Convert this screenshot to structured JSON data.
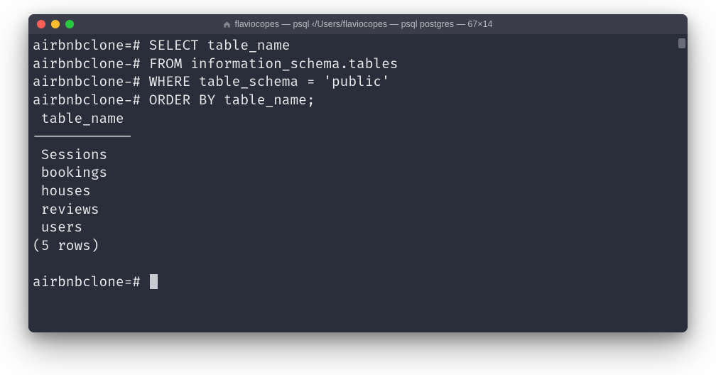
{
  "window": {
    "title": "flaviocopes — psql ‹/Users/flaviocopes — psql postgres — 67×14"
  },
  "prompts": {
    "main": "airbnbclone=#",
    "cont": "airbnbclone-#"
  },
  "query": {
    "line1": "SELECT table_name",
    "line2": "FROM information_schema.tables",
    "line3": "WHERE table_schema = 'public'",
    "line4": "ORDER BY table_name;"
  },
  "result": {
    "header": " table_name ",
    "divider": "------------",
    "rows": [
      " Sessions",
      " bookings",
      " houses",
      " reviews",
      " users"
    ],
    "summary": "(5 rows)"
  }
}
